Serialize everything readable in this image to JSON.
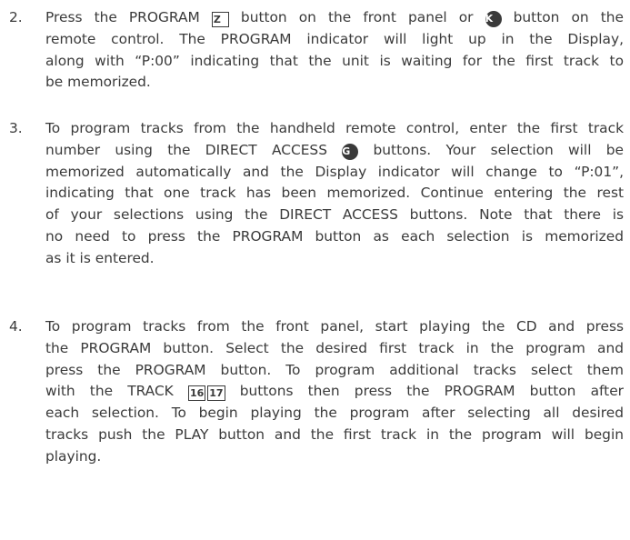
{
  "steps": [
    {
      "number": "2.",
      "lines": [
        [
          "Press the PROGRAM ",
          {
            "box": "Z"
          },
          " button on the front panel or ",
          {
            "circle": "K"
          },
          " button on the"
        ],
        [
          "remote control. The PROGRAM indicator will light up in the Display,"
        ],
        [
          "along with “P:00” indicating that the unit is waiting for the first track to"
        ],
        [
          "be memorized."
        ]
      ]
    },
    {
      "number": "3.",
      "lines": [
        [
          "To program tracks from the handheld remote control, enter the first track"
        ],
        [
          "number using the DIRECT ACCESS ",
          {
            "circle": "G"
          },
          " buttons. Your selection will be"
        ],
        [
          "memorized automatically and the Display indicator will change to “P:01”,"
        ],
        [
          "indicating that one track has been memorized. Continue entering the rest"
        ],
        [
          "of your selections using the DIRECT ACCESS buttons. Note that there is"
        ],
        [
          "no need to press the PROGRAM button as each selection is memorized"
        ],
        [
          "as it is entered."
        ]
      ]
    },
    {
      "number": "4.",
      "lines": [
        [
          "To program tracks from the front panel, start playing the CD and press"
        ],
        [
          "the PROGRAM button. Select the desired first track in the program and"
        ],
        [
          "press the PROGRAM button.  To program additional tracks select them"
        ],
        [
          "with the TRACK ",
          {
            "box": "16"
          },
          {
            "box": "17"
          },
          " buttons then press the PROGRAM button after"
        ],
        [
          "each selection. To begin playing the program after selecting all desired"
        ],
        [
          "tracks push the PLAY button and the first track in the program will begin"
        ],
        [
          "playing."
        ]
      ]
    }
  ]
}
